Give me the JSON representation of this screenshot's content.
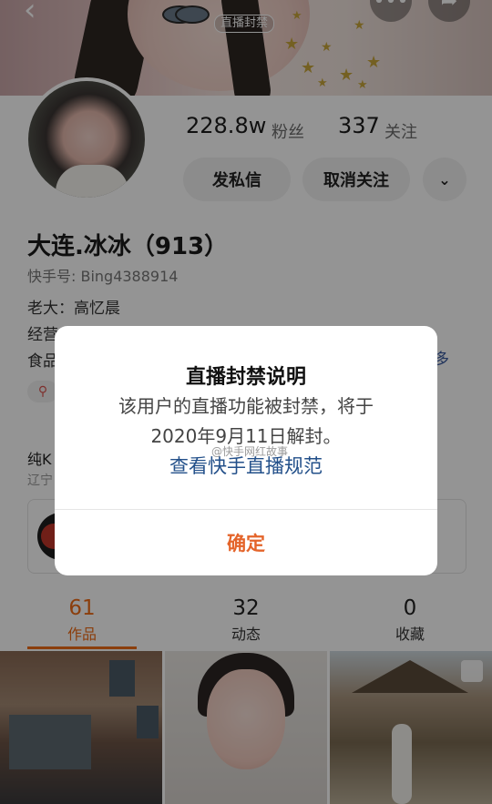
{
  "header": {
    "ban_tag": "直播封禁",
    "back_icon": "back-arrow-icon",
    "more_icon": "more-dots-icon",
    "share_icon": "share-arrow-icon"
  },
  "profile": {
    "followers_count": "228.8w",
    "followers_label": "粉丝",
    "following_count": "337",
    "following_label": "关注",
    "message_button": "发私信",
    "unfollow_button": "取消关注",
    "name": "大连.冰冰（913）",
    "kuaishou_id": "快手号: Bing4388914",
    "intro_line1": "老大：高忆晨",
    "intro_line2": "经营",
    "intro_line3": "食品",
    "more_link": "多"
  },
  "section": {
    "title": "纯K",
    "subtitle": "辽宁"
  },
  "tabs": [
    {
      "count": "61",
      "label": "作品",
      "active": true
    },
    {
      "count": "32",
      "label": "动态",
      "active": false
    },
    {
      "count": "0",
      "label": "收藏",
      "active": false
    }
  ],
  "dialog": {
    "title": "直播封禁说明",
    "body_line1": "该用户的直播功能被封禁，将于",
    "body_line2": "2020年9月11日解封。",
    "link": "查看快手直播规范",
    "confirm": "确定"
  },
  "watermark": "@快手网红故事",
  "colors": {
    "accent": "#ef6b16",
    "link": "#23508a",
    "confirm": "#e4642a"
  }
}
